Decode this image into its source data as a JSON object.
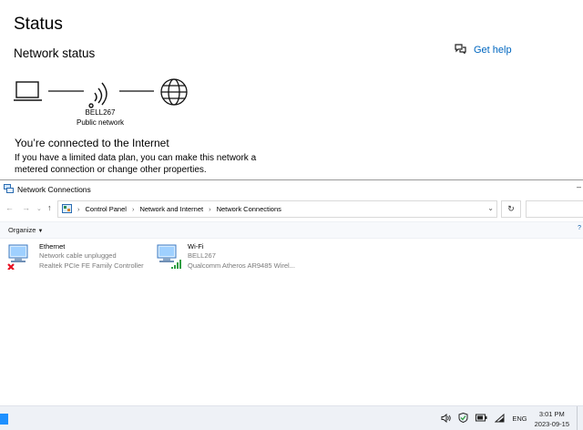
{
  "settings": {
    "title": "Status",
    "network_status": "Network status",
    "get_help": "Get help",
    "network_name": "BELL267",
    "network_type": "Public network",
    "connected_text": "You’re connected to the Internet",
    "description": "If you have a limited data plan, you can make this network a metered connection or change other properties.",
    "icons": [
      "laptop-icon",
      "wifi-icon",
      "globe-icon",
      "chat-help-icon"
    ]
  },
  "explorer": {
    "window_title": "Network Connections",
    "breadcrumb": [
      "Control Panel",
      "Network and Internet",
      "Network Connections"
    ],
    "toolbar": {
      "organize": "Organize"
    },
    "adapters": [
      {
        "name": "Ethernet",
        "status": "Network cable unplugged",
        "device": "Realtek PCIe FE Family Controller",
        "icon": "ethernet-disconnected-icon"
      },
      {
        "name": "Wi-Fi",
        "status": "BELL267",
        "device": "Qualcomm Atheros AR9485 Wirel...",
        "icon": "wifi-adapter-icon"
      }
    ]
  },
  "taskbar": {
    "language": "ENG",
    "time": "3:01 PM",
    "date": "2023-09-15",
    "tray_icons": [
      "volume-icon",
      "security-icon",
      "battery-icon",
      "wifi-tray-icon"
    ]
  },
  "colors": {
    "link": "#0067c0",
    "taskbar": "#eef1f6",
    "toolbar": "#f7f9fc",
    "error": "#e81123",
    "signal": "#2f9e44"
  }
}
